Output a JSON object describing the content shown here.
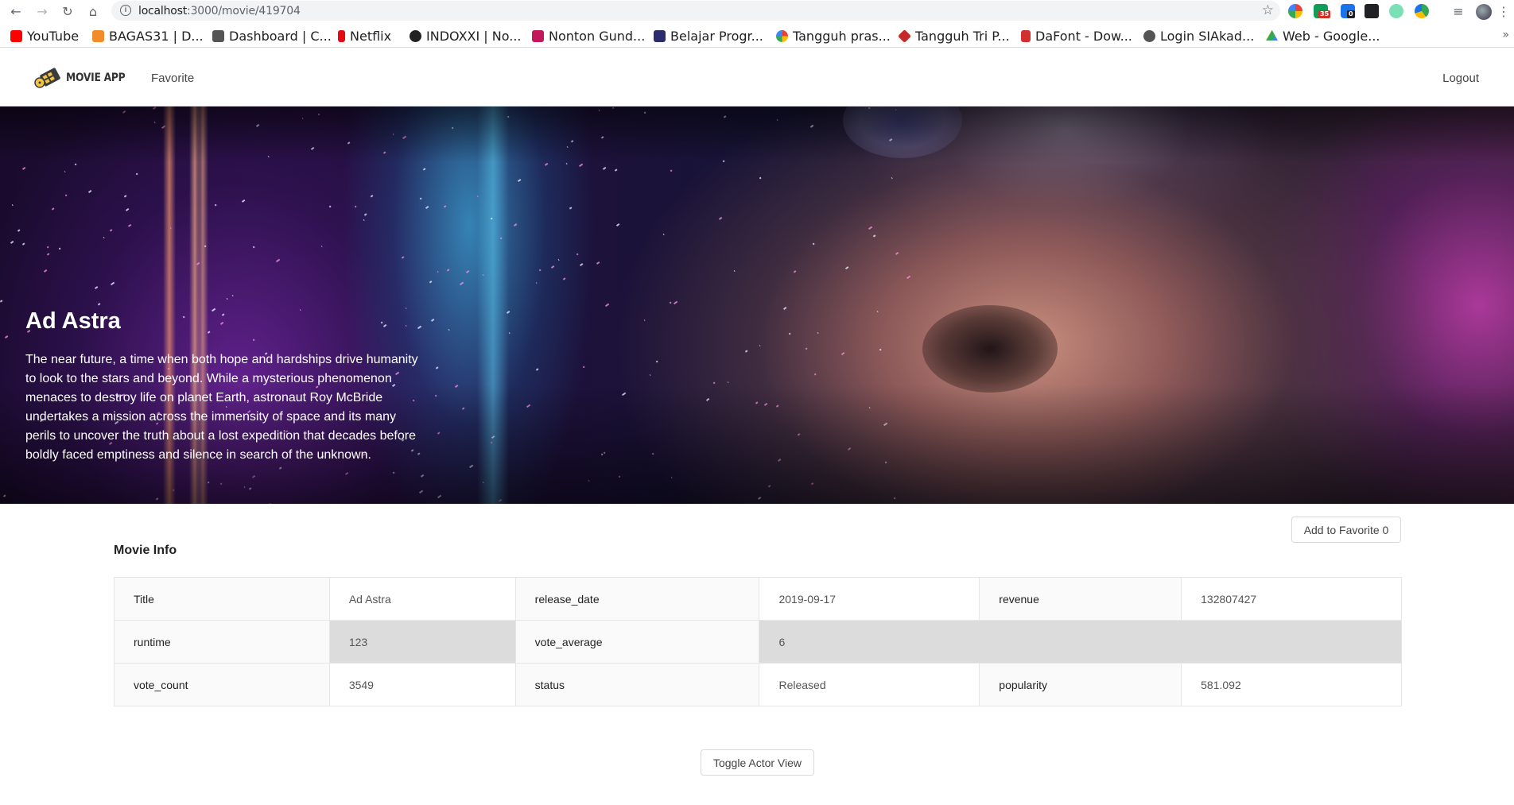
{
  "browser": {
    "url_host": "localhost",
    "url_path": ":3000/movie/419704",
    "bookmarks": [
      {
        "label": "YouTube",
        "color": "#ff0000"
      },
      {
        "label": "BAGAS31 | D...",
        "color": "#f28c28"
      },
      {
        "label": "Dashboard | C...",
        "color": "#555555"
      },
      {
        "label": "Netflix",
        "color": "#e50914"
      },
      {
        "label": "INDOXXI | No...",
        "color": "#222222"
      },
      {
        "label": "Nonton Gund...",
        "color": "#c2185b"
      },
      {
        "label": "Belajar Progr...",
        "color": "#2c2c6c"
      },
      {
        "label": "Tangguh pras...",
        "color": "#4285f4"
      },
      {
        "label": "Tangguh Tri P...",
        "color": "#c62828"
      },
      {
        "label": "DaFont - Dow...",
        "color": "#d32f2f"
      },
      {
        "label": "Login SIAkad...",
        "color": "#555555"
      },
      {
        "label": "Web - Google...",
        "color": "#fbbc04"
      }
    ],
    "more": "»",
    "ext_badges": [
      "35",
      "0"
    ]
  },
  "nav": {
    "logo_text": "MOVIE APP",
    "favorite_link": "Favorite",
    "logout_link": "Logout"
  },
  "hero": {
    "title": "Ad Astra",
    "overview": "The near future, a time when both hope and hardships drive humanity to look to the stars and beyond. While a mysterious phenomenon menaces to destroy life on planet Earth, astronaut Roy McBride undertakes a mission across the immensity of space and its many perils to uncover the truth about a lost expedition that decades before boldly faced emptiness and silence in search of the unknown."
  },
  "actions": {
    "add_favorite": "Add to Favorite 0",
    "toggle_actor": "Toggle Actor View"
  },
  "movie_info": {
    "heading": "Movie Info",
    "rows": [
      [
        {
          "label": "Title",
          "value": "Ad Astra"
        },
        {
          "label": "release_date",
          "value": "2019-09-17"
        },
        {
          "label": "revenue",
          "value": "132807427"
        }
      ],
      [
        {
          "label": "runtime",
          "value": "123"
        },
        {
          "label": "vote_average",
          "value": "6"
        },
        {
          "label": "",
          "value": ""
        }
      ],
      [
        {
          "label": "vote_count",
          "value": "3549"
        },
        {
          "label": "status",
          "value": "Released"
        },
        {
          "label": "popularity",
          "value": "581.092"
        }
      ]
    ]
  }
}
